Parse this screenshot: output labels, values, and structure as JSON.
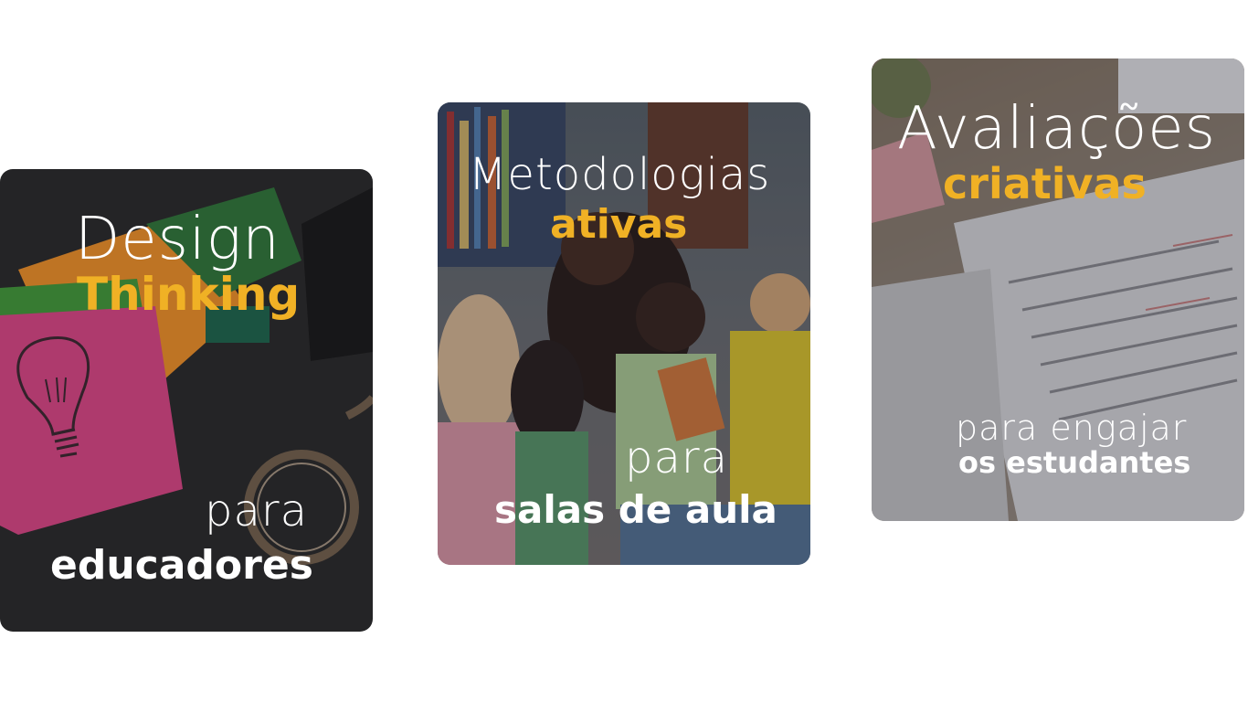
{
  "cards": [
    {
      "title_light": "Design",
      "title_bold": "Thinking",
      "sub_light": "para",
      "sub_bold": "educadores"
    },
    {
      "title_light": "Metodologias",
      "title_bold": "ativas",
      "sub_light": "para",
      "sub_bold": "salas de aula"
    },
    {
      "title_light": "Avaliações",
      "title_bold": "criativas",
      "sub_light": "para engajar",
      "sub_bold": "os estudantes"
    }
  ],
  "colors": {
    "accent": "#f0b125",
    "text": "#ffffff",
    "page_bg": "#ffffff"
  },
  "icons": {
    "card1": "lightbulb-sticky-note-icon"
  }
}
